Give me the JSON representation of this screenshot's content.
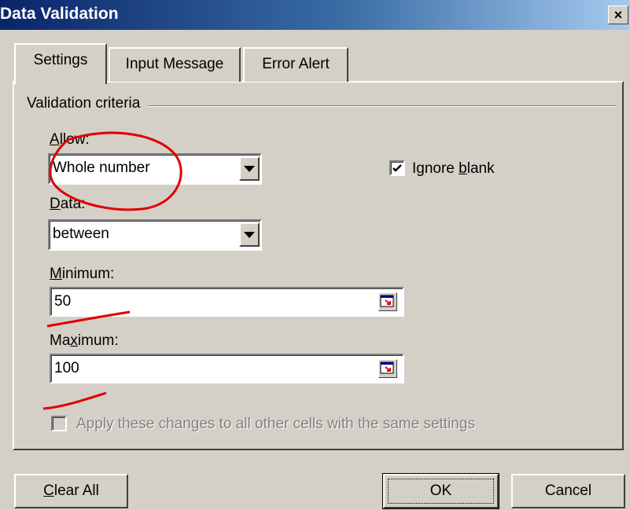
{
  "window": {
    "title": "Data Validation",
    "close_glyph": "×"
  },
  "tabs": [
    {
      "label": "Settings",
      "active": true
    },
    {
      "label": "Input Message",
      "active": false
    },
    {
      "label": "Error Alert",
      "active": false
    }
  ],
  "group": {
    "label": "Validation criteria"
  },
  "allow": {
    "label_u": "A",
    "label_rest": "llow:",
    "value": "Whole number"
  },
  "data": {
    "label_u": "D",
    "label_rest": "ata:",
    "value": "between"
  },
  "minimum": {
    "label_u": "M",
    "label_rest": "inimum:",
    "value": "50"
  },
  "maximum": {
    "label_pre": "Ma",
    "label_u": "x",
    "label_rest": "imum:",
    "value": "100"
  },
  "ignore_blank": {
    "label_pre": "Ignore ",
    "label_u": "b",
    "label_rest": "lank",
    "checked": true
  },
  "apply_all": {
    "label": "Apply these changes to all other cells with the same settings",
    "checked": false,
    "enabled": false
  },
  "buttons": {
    "clear_all": {
      "label_u": "C",
      "label_rest": "lear All"
    },
    "ok": "OK",
    "cancel": "Cancel"
  },
  "annotation_color": "#e00000"
}
